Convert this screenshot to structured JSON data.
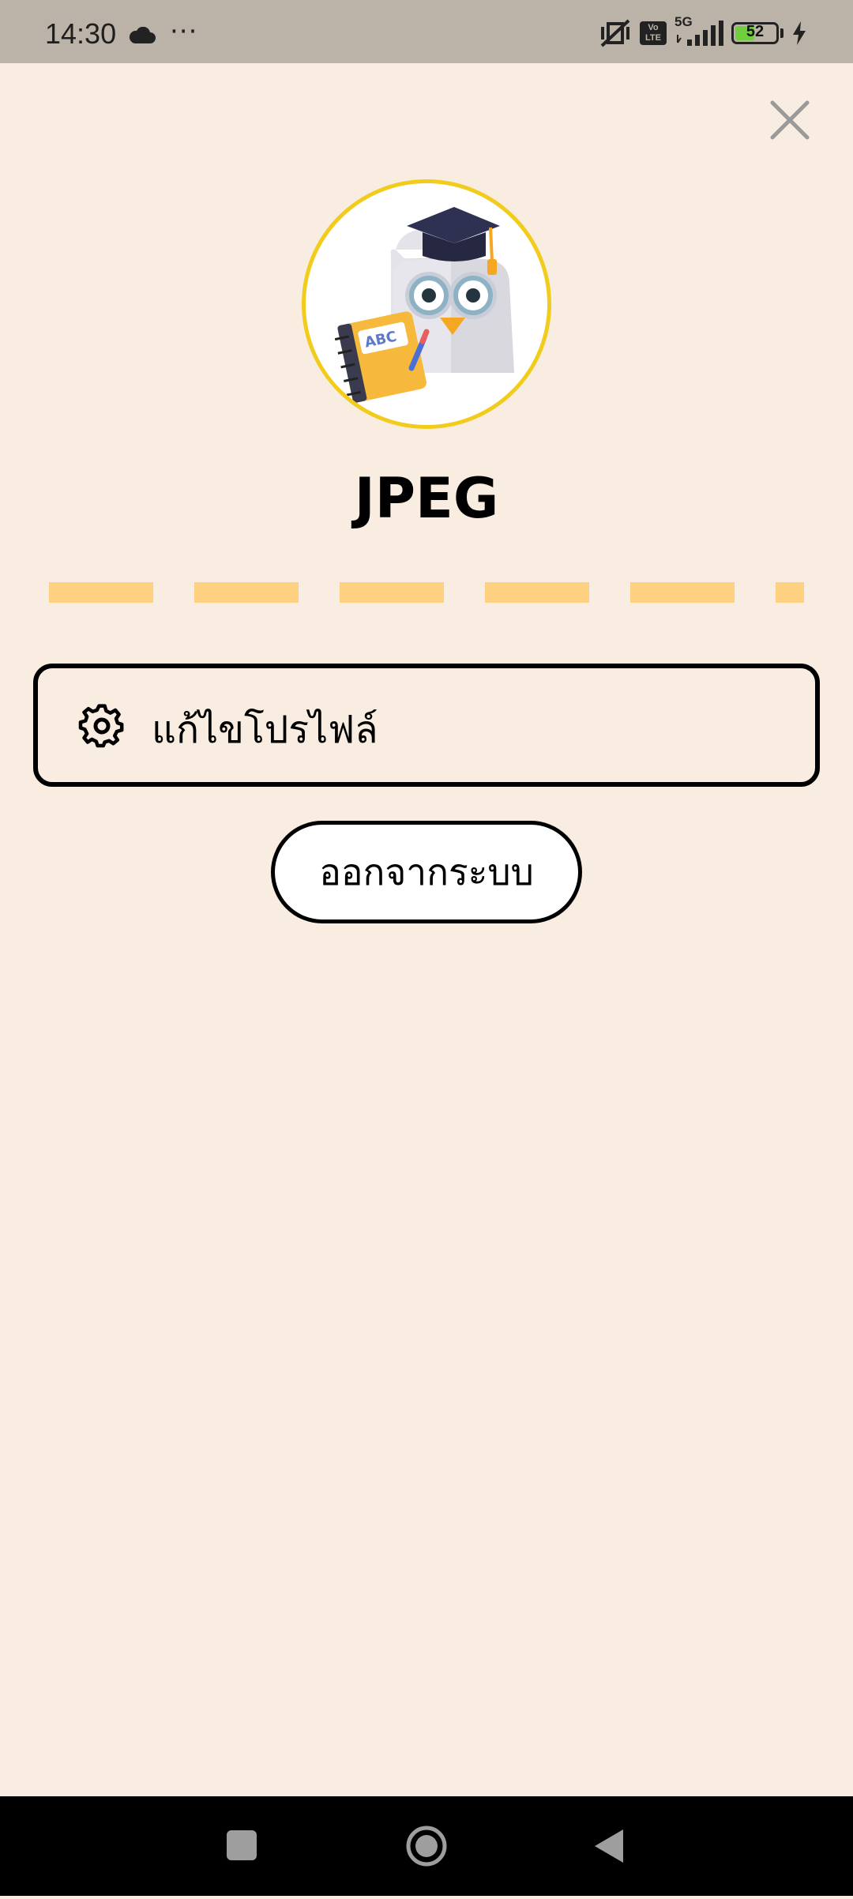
{
  "status_bar": {
    "time": "14:30",
    "more": "···",
    "network": "5G",
    "volte": "Vo LTE",
    "battery_level": "52",
    "battery_fraction": 0.52
  },
  "profile": {
    "name": "JPEG",
    "avatar_icon": "owl-graduate-avatar"
  },
  "menu": {
    "edit_profile_label": "แก้ไขโปรไฟล์",
    "logout_label": "ออกจากระบบ"
  },
  "colors": {
    "background": "#f8ede0",
    "avatar_border": "#f2cc1d",
    "divider": "#fdd180"
  },
  "icons": {
    "close": "close-icon",
    "gear": "gear-icon",
    "nav_recents": "square-icon",
    "nav_home": "circle-icon",
    "nav_back": "triangle-back-icon"
  }
}
